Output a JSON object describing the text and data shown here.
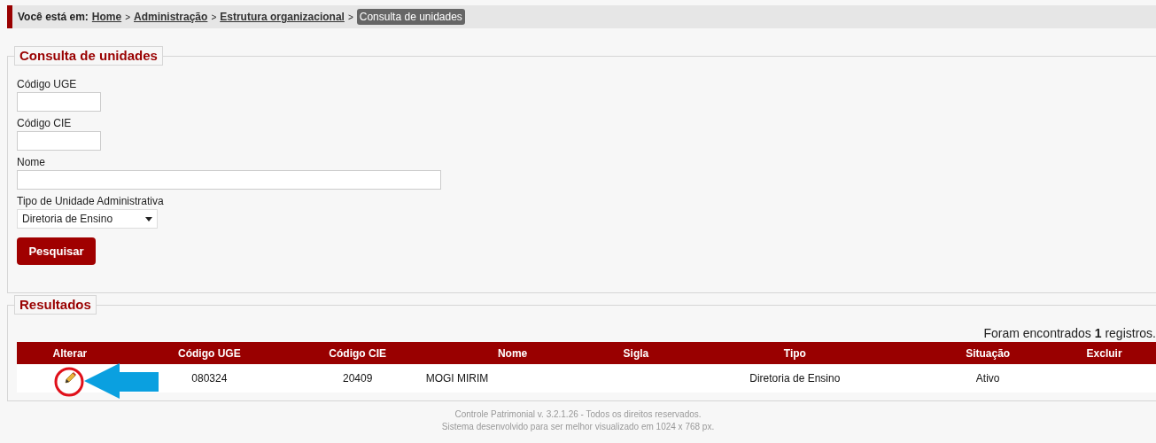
{
  "breadcrumb": {
    "label": "Você está em:",
    "links": [
      "Home",
      "Administração",
      "Estrutura organizacional"
    ],
    "separator": ">",
    "current": "Consulta de unidades"
  },
  "search_form": {
    "legend": "Consulta de unidades",
    "fields": [
      {
        "kind": "short_text",
        "label": "Código UGE"
      },
      {
        "kind": "short_text",
        "label": "Código CIE"
      },
      {
        "kind": "long_text",
        "label": "Nome"
      },
      {
        "kind": "select",
        "label": "Tipo de Unidade Administrativa",
        "value": "Diretoria de Ensino"
      }
    ],
    "button": "Pesquisar"
  },
  "results": {
    "legend": "Resultados",
    "count_text": "Foram encontrados **1** registros.",
    "columns": [
      "Alterar",
      "Código UGE",
      "Código CIE",
      "Nome",
      "Sigla",
      "Tipo",
      "Situação",
      "Excluir"
    ],
    "rows": [
      {
        "codigo_uge": "080324",
        "codigo_cie": "20409",
        "nome": "MOGI MIRIM",
        "sigla": "",
        "tipo": "Diretoria de Ensino",
        "situacao": "Ativo"
      }
    ]
  },
  "footer": [
    "Controle Patrimonial v. 3.2.1.26 - Todos os direitos reservados.",
    "Sistema desenvolvido para ser melhor visualizado em 1024 x 768 px."
  ]
}
